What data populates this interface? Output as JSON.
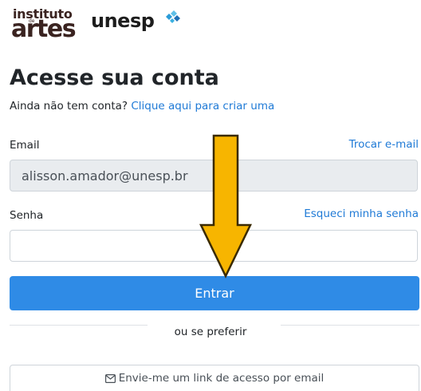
{
  "logo": {
    "line1": "instituto",
    "line2": "de",
    "line3": "artes",
    "unesp": "unesp"
  },
  "heading": {
    "title": "Acesse sua conta",
    "no_account_text": "Ainda não tem conta?",
    "signup_link": "Clique aqui para criar uma"
  },
  "email": {
    "label": "Email",
    "change_link": "Trocar e-mail",
    "value": "alisson.amador@unesp.br"
  },
  "password": {
    "label": "Senha",
    "forgot_link": "Esqueci minha senha",
    "value": ""
  },
  "login_button": "Entrar",
  "divider_text": "ou se preferir",
  "email_link_button": "Envie-me um link de acesso por email",
  "colors": {
    "primary": "#2f8be6",
    "link": "#1f7ad6",
    "arrow_fill": "#f7b500",
    "arrow_stroke": "#3a2a00"
  },
  "icons": {
    "email_button_icon": "envelope-icon",
    "annotation": "arrow-down-icon"
  }
}
